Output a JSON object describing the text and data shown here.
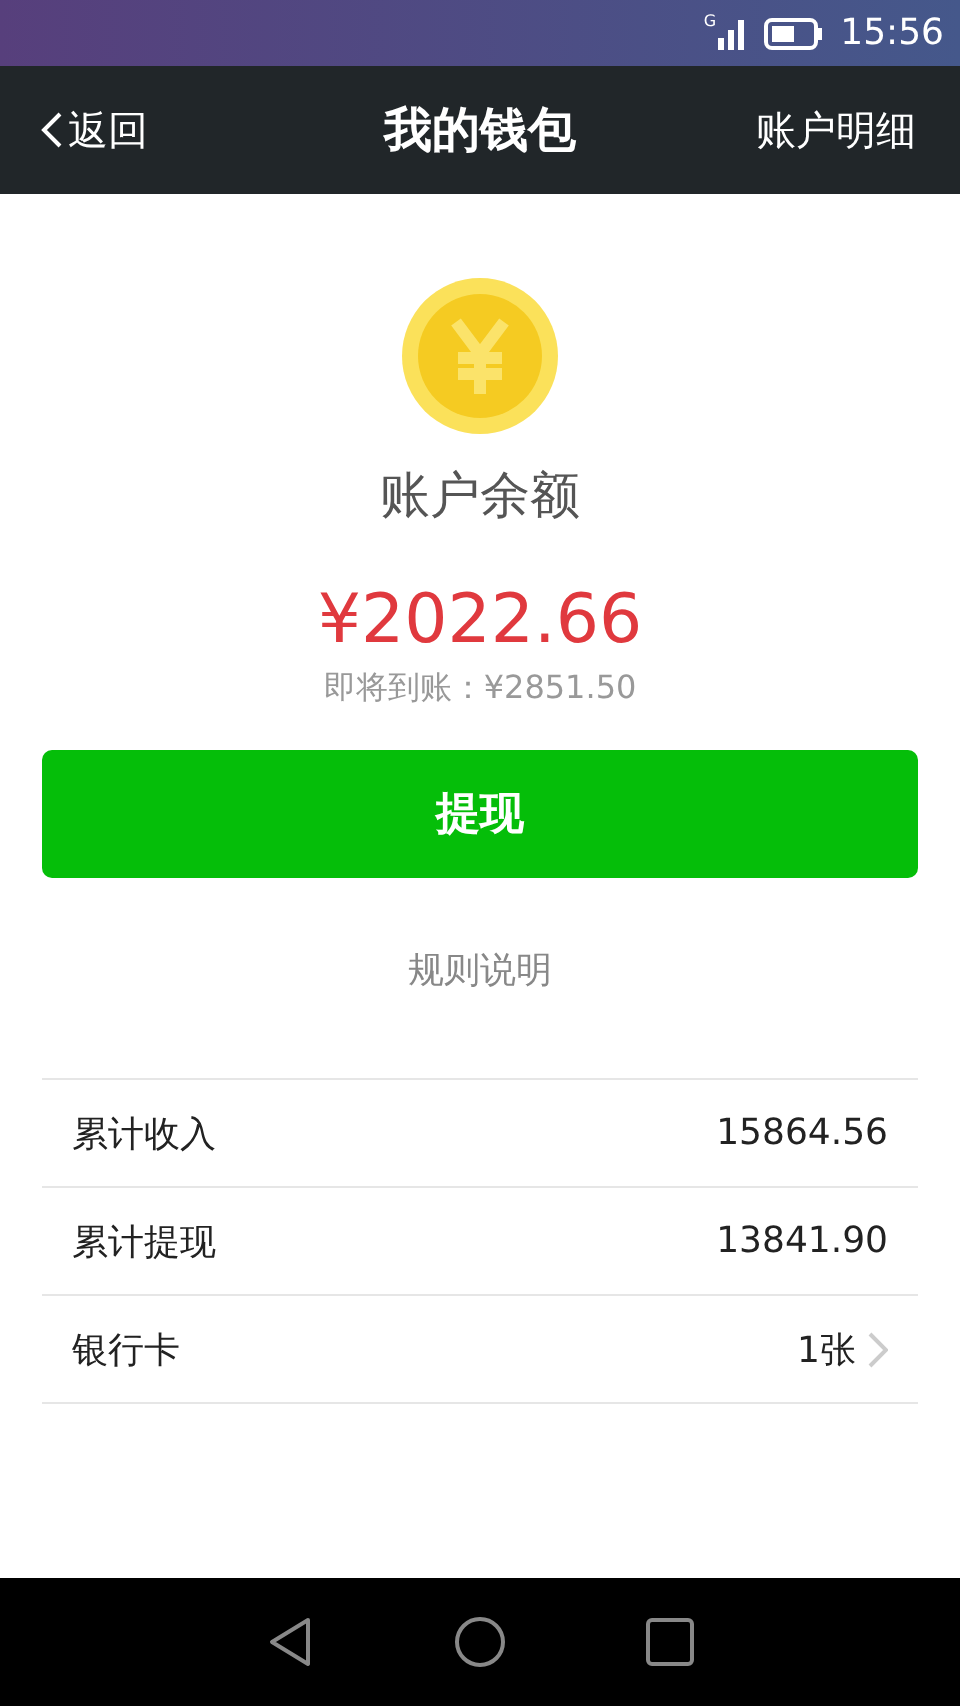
{
  "status_bar": {
    "network": "G",
    "time": "15:56"
  },
  "header": {
    "back": "返回",
    "title": "我的钱包",
    "action": "账户明细"
  },
  "balance": {
    "label": "账户余额",
    "amount": "¥2022.66",
    "pending": "即将到账：¥2851.50"
  },
  "withdraw_button": "提现",
  "rules_link": "规则说明",
  "rows": [
    {
      "kind": "value",
      "label": "累计收入",
      "value": "15864.56"
    },
    {
      "kind": "value",
      "label": "累计提现",
      "value": "13841.90"
    },
    {
      "kind": "link",
      "label": "银行卡",
      "value": "1张"
    }
  ]
}
